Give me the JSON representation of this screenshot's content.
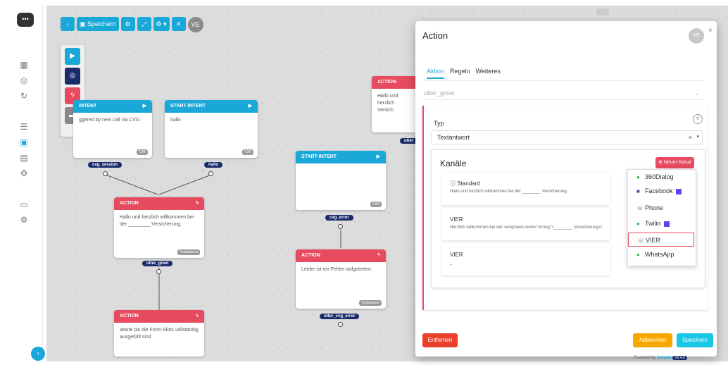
{
  "toolbar": {
    "save_label": "Speichern",
    "avatar": "VE"
  },
  "canvas": {
    "nodes": [
      {
        "header": "INTENT",
        "body": "ggered by new call via CVG",
        "tag": "T.2R"
      },
      {
        "header": "START-INTENT",
        "body": "hallo",
        "tag": "T.2R"
      },
      {
        "header": "ACTION",
        "body": "Hallo und herzlich willkommen bei der ________ Versicherung.",
        "tag": "Textantwort"
      },
      {
        "header": "ACTION",
        "body": "Warte bis die Form-Slots vollständig ausgefüllt sind",
        "tag": ""
      },
      {
        "header": "START-INTENT",
        "body": "",
        "tag": "T.2R"
      },
      {
        "header": "ACTION",
        "body": "Leider ist ein Fehler aufgetreten.",
        "tag": "Textantwort"
      },
      {
        "header": "ACTION",
        "body": "Hallo und herzlich",
        "sub": "Versich",
        "tag": ""
      }
    ],
    "pills": [
      "cvg_session",
      "hallo",
      "utter_greet",
      "cvg_error",
      "utter_cvg_error",
      "utter"
    ]
  },
  "modal": {
    "title": "Action",
    "avatar": "VE",
    "close": "×",
    "tabs": [
      "Aktion",
      "Regeln",
      "Weiteres"
    ],
    "action_name": "utter_greet",
    "typ_label": "Typ",
    "typ_value": "Textantwort",
    "kanaele_title": "Kanäle",
    "new_kanal": "Neuer Kanal",
    "channels": [
      {
        "name": "Standard",
        "text": "Hallo und herzlich willkommen bei der ________ Versicherung."
      },
      {
        "name": "VIER",
        "text": "Herzlich willkommen bei der <emphasis level=\"strong\">________ Versicherung</"
      },
      {
        "name": "VIER",
        "text": "–"
      }
    ],
    "dropdown": [
      {
        "label": "360Dialog",
        "icon": "whatsapp-icon"
      },
      {
        "label": "Facebook",
        "icon": "facebook-icon",
        "badge": true
      },
      {
        "label": "Phone",
        "icon": "phone-icon"
      },
      {
        "label": "Twilio",
        "icon": "whatsapp-icon",
        "badge": true
      },
      {
        "label": "VIER",
        "icon": "phone-icon",
        "selected": true
      },
      {
        "label": "WhatsApp",
        "icon": "whatsapp-icon"
      }
    ],
    "remove_label": "Entfernen",
    "cancel_label": "Abbrechen",
    "save_label": "Speichern"
  },
  "footer": {
    "powered": "Powered by",
    "brand": "botario",
    "version": "V6.4.0"
  },
  "colors": {
    "accent": "#1aa8d8",
    "danger": "#e84a5f",
    "warning": "#f6a800",
    "navy": "#1a2b6b"
  }
}
